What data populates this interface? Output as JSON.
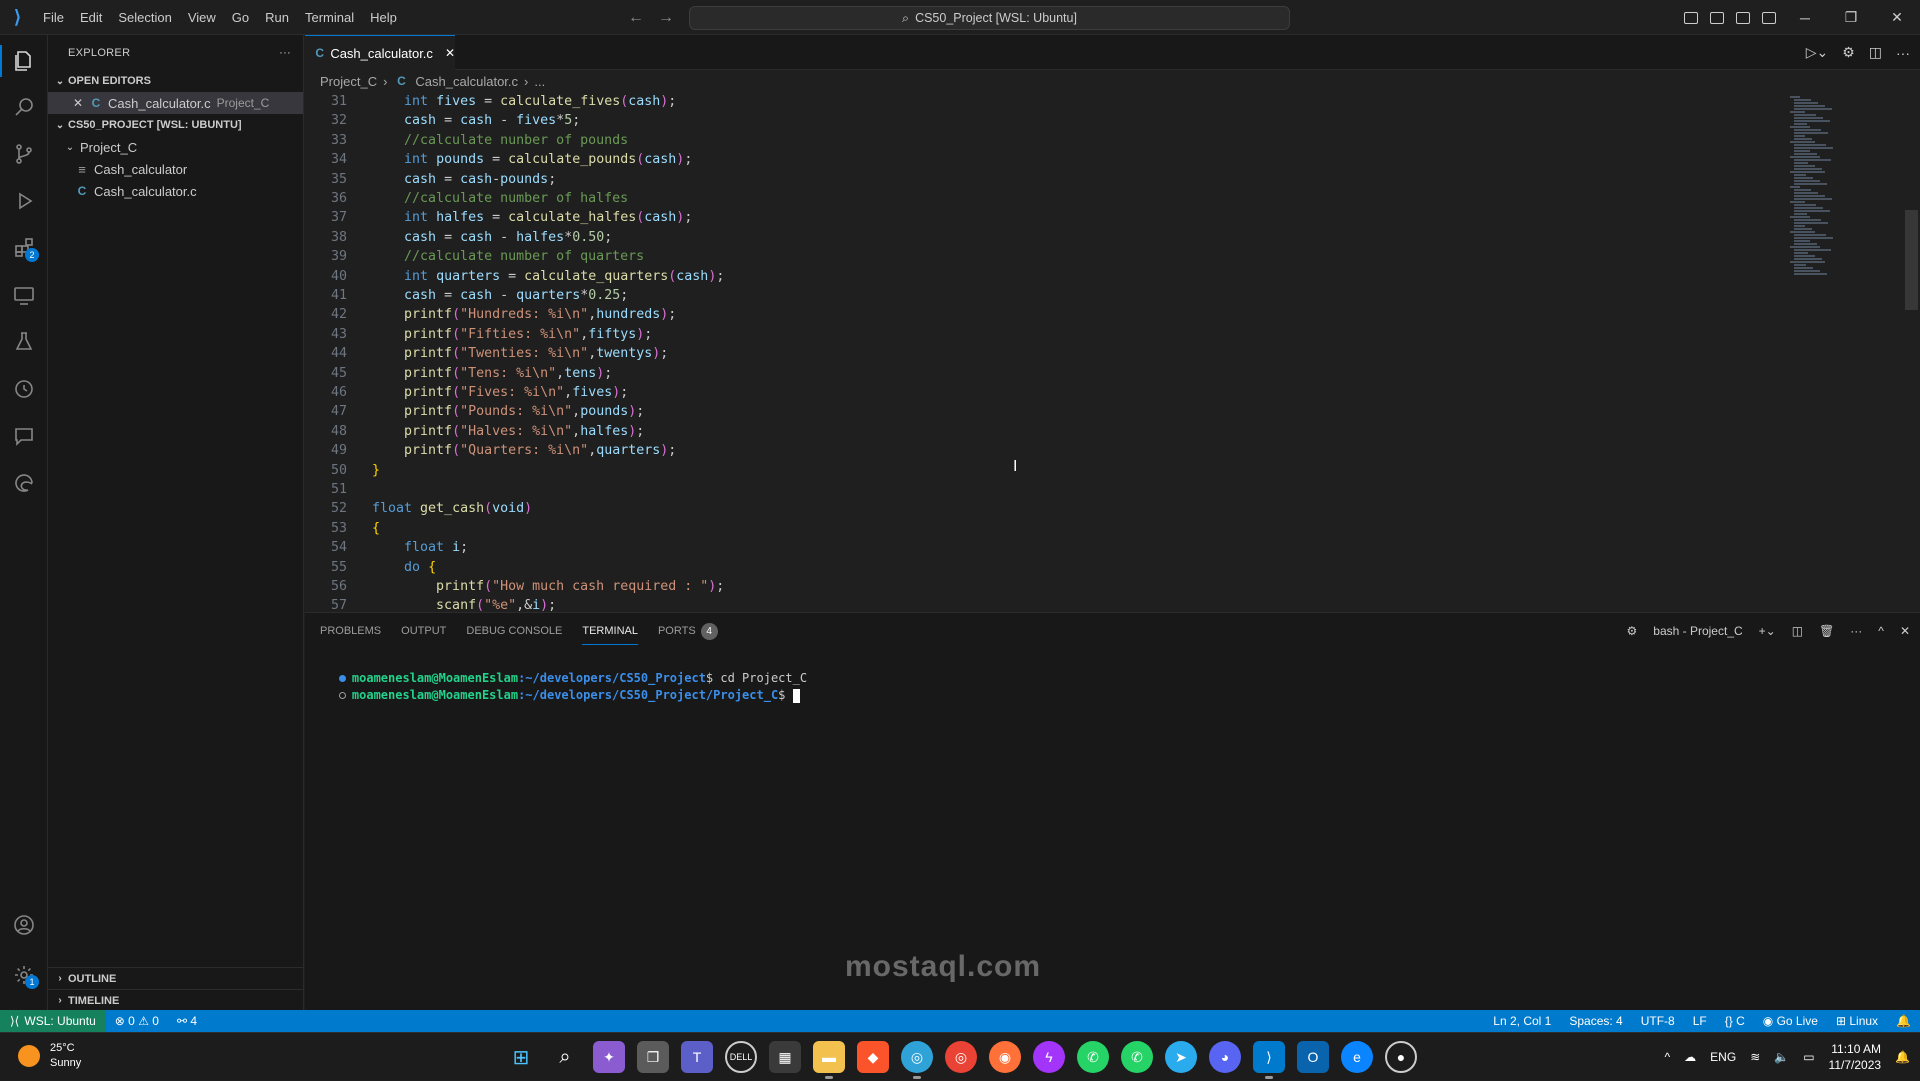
{
  "titlebar": {
    "menu": [
      "File",
      "Edit",
      "Selection",
      "View",
      "Go",
      "Run",
      "Terminal",
      "Help"
    ],
    "command_center": "CS50_Project [WSL: Ubuntu]"
  },
  "activity": {
    "extensions_badge": "2",
    "settings_badge": "1"
  },
  "sidebar": {
    "title": "EXPLORER",
    "more": "···",
    "open_editors": "OPEN EDITORS",
    "open_file": "Cash_calculator.c",
    "open_file_desc": "Project_C",
    "workspace": "CS50_PROJECT [WSL: UBUNTU]",
    "folder": "Project_C",
    "file1": "Cash_calculator",
    "file2": "Cash_calculator.c",
    "outline": "OUTLINE",
    "timeline": "TIMELINE"
  },
  "editor": {
    "tab": "Cash_calculator.c",
    "breadcrumb_folder": "Project_C",
    "breadcrumb_file": "Cash_calculator.c",
    "breadcrumb_more": "..."
  },
  "code": [
    {
      "n": "31",
      "t": "    int fives = calculate_fives(cash);"
    },
    {
      "n": "32",
      "t": "    cash = cash - fives*5;"
    },
    {
      "n": "33",
      "t": "    //calculate nunber of pounds"
    },
    {
      "n": "34",
      "t": "    int pounds = calculate_pounds(cash);"
    },
    {
      "n": "35",
      "t": "    cash = cash-pounds;"
    },
    {
      "n": "36",
      "t": "    //calculate number of halfes"
    },
    {
      "n": "37",
      "t": "    int halfes = calculate_halfes(cash);"
    },
    {
      "n": "38",
      "t": "    cash = cash - halfes*0.50;"
    },
    {
      "n": "39",
      "t": "    //calculate number of quarters"
    },
    {
      "n": "40",
      "t": "    int quarters = calculate_quarters(cash);"
    },
    {
      "n": "41",
      "t": "    cash = cash - quarters*0.25;"
    },
    {
      "n": "42",
      "t": "    printf(\"Hundreds: %i\\n\",hundreds);"
    },
    {
      "n": "43",
      "t": "    printf(\"Fifties: %i\\n\",fiftys);"
    },
    {
      "n": "44",
      "t": "    printf(\"Twenties: %i\\n\",twentys);"
    },
    {
      "n": "45",
      "t": "    printf(\"Tens: %i\\n\",tens);"
    },
    {
      "n": "46",
      "t": "    printf(\"Fives: %i\\n\",fives);"
    },
    {
      "n": "47",
      "t": "    printf(\"Pounds: %i\\n\",pounds);"
    },
    {
      "n": "48",
      "t": "    printf(\"Halves: %i\\n\",halfes);"
    },
    {
      "n": "49",
      "t": "    printf(\"Quarters: %i\\n\",quarters);"
    },
    {
      "n": "50",
      "t": "}"
    },
    {
      "n": "51",
      "t": ""
    },
    {
      "n": "52",
      "t": "float get_cash(void)"
    },
    {
      "n": "53",
      "t": "{"
    },
    {
      "n": "54",
      "t": "    float i;"
    },
    {
      "n": "55",
      "t": "    do {"
    },
    {
      "n": "56",
      "t": "        printf(\"How much cash required : \");"
    },
    {
      "n": "57",
      "t": "        scanf(\"%e\",&i);"
    }
  ],
  "panel": {
    "tabs": [
      "PROBLEMS",
      "OUTPUT",
      "DEBUG CONSOLE",
      "TERMINAL",
      "PORTS"
    ],
    "ports_count": "4",
    "terminal_name": "bash - Project_C",
    "line1_user": "moameneslam@MoamenEslam",
    "line1_path": ":~/developers/CS50_Project",
    "line1_cmd": "$ cd Project_C",
    "line2_user": "moameneslam@MoamenEslam",
    "line2_path": ":~/developers/CS50_Project/Project_C",
    "line2_cmd": "$ "
  },
  "status": {
    "remote": "WSL: Ubuntu",
    "errors": "0",
    "warnings": "0",
    "ports": "4",
    "position": "Ln 2, Col 1",
    "spaces": "Spaces: 4",
    "encoding": "UTF-8",
    "eol": "LF",
    "language": "C",
    "golive": "Go Live",
    "platform": "Linux"
  },
  "taskbar": {
    "temp": "25°C",
    "weather": "Sunny",
    "lang": "ENG",
    "time": "11:10 AM",
    "date": "11/7/2023"
  },
  "watermark": "mostaql.com",
  "colors": {
    "accent": "#0078d4",
    "statusbar": "#007acc",
    "remote": "#16825d"
  }
}
